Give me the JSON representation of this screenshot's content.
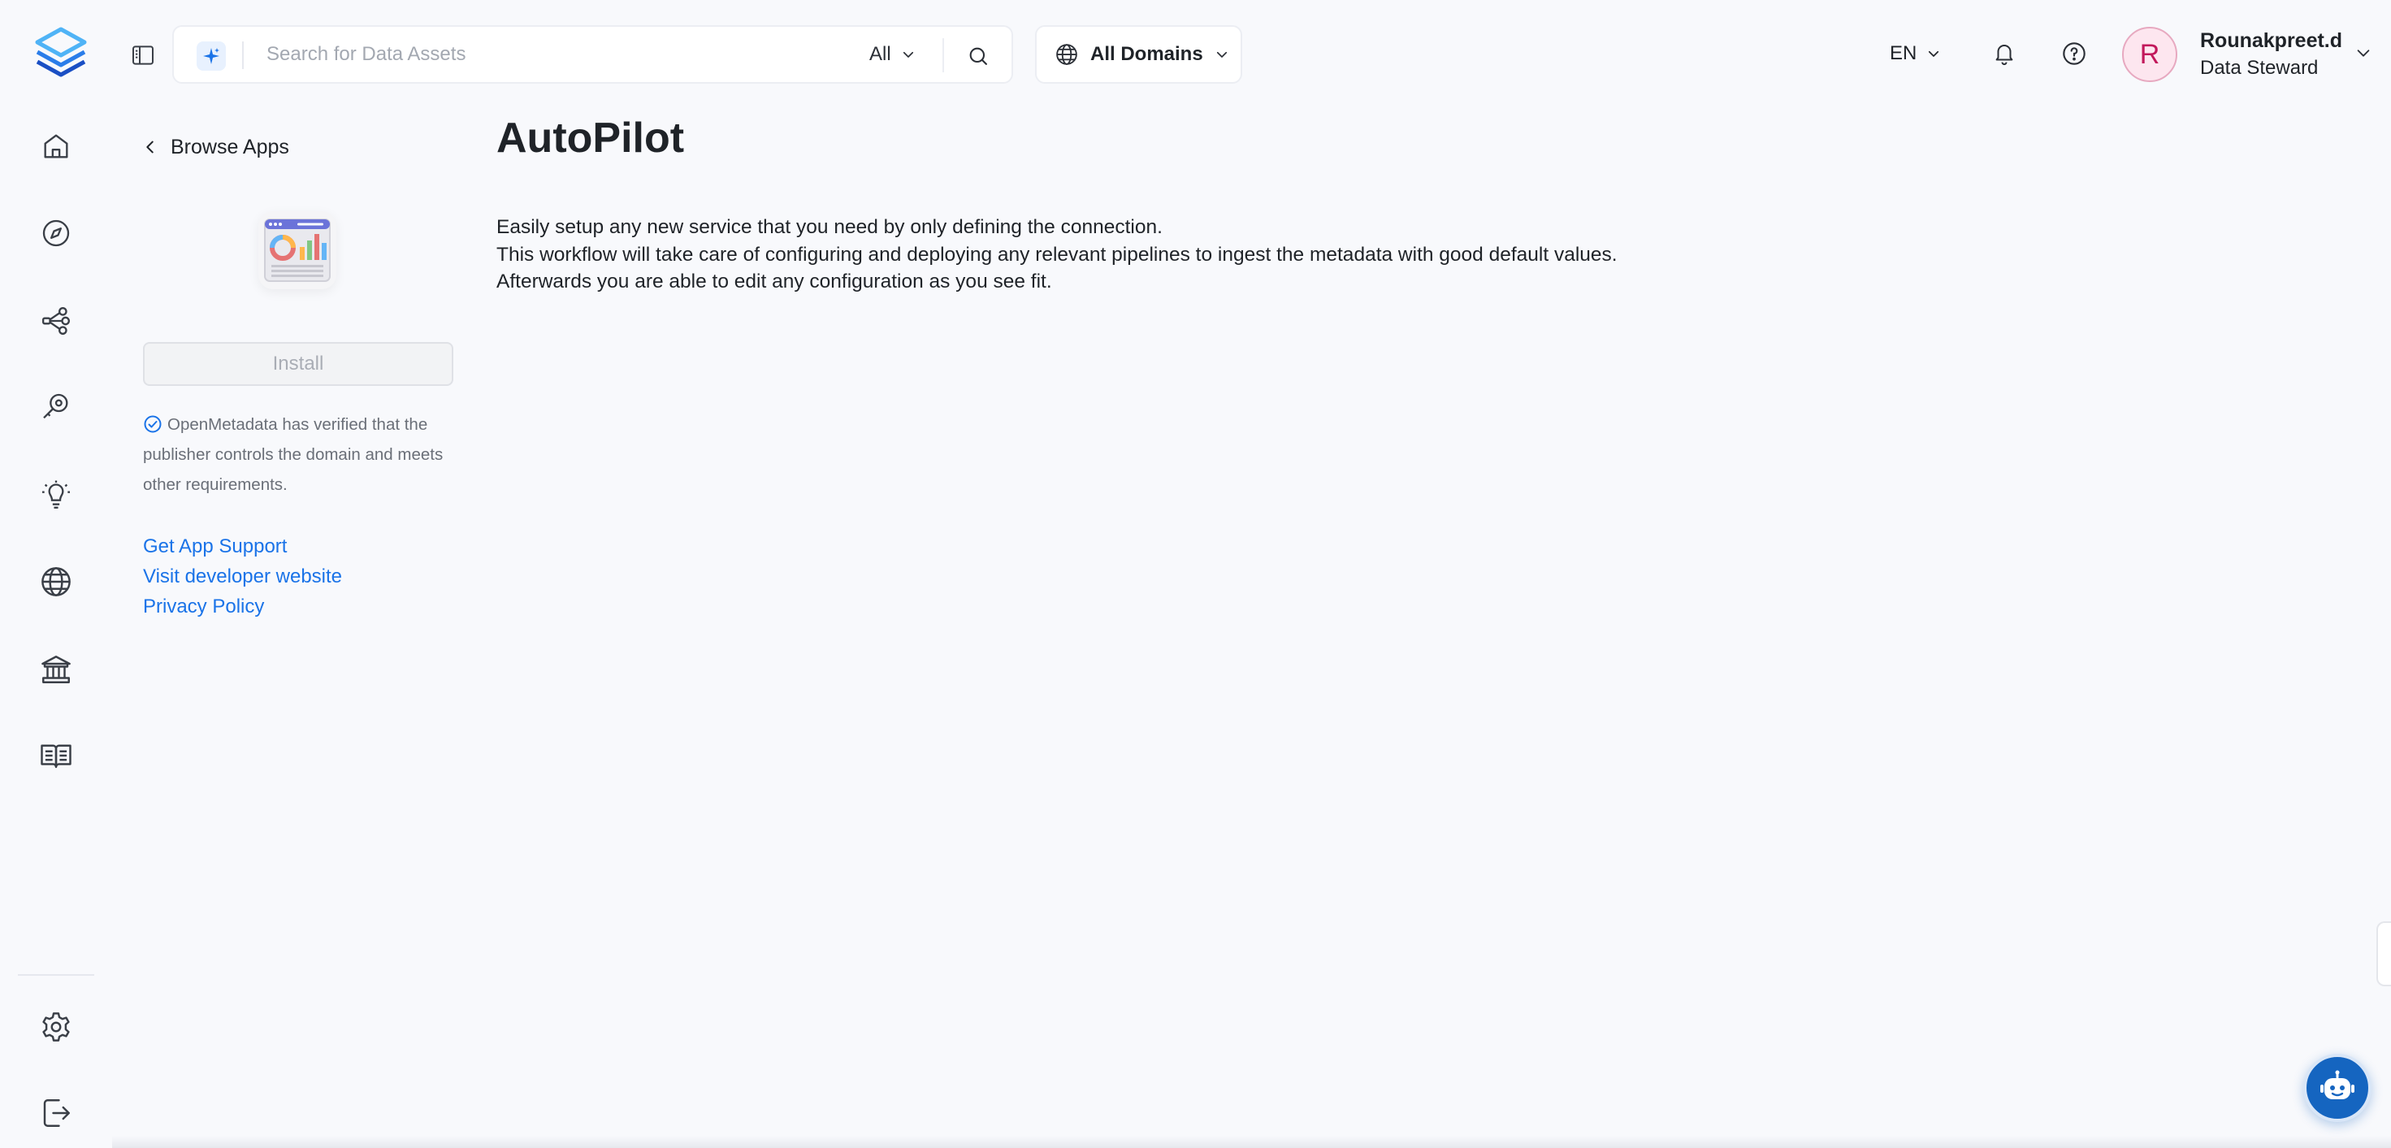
{
  "header": {
    "search": {
      "placeholder": "Search for Data Assets",
      "value": "",
      "filter_label": "All"
    },
    "domain_selector": "All Domains",
    "language": "EN",
    "user": {
      "initial": "R",
      "name": "Rounakpreet.d",
      "role": "Data Steward"
    }
  },
  "nav": {
    "items": [
      "home-icon",
      "explore-icon",
      "lineage-icon",
      "observability-icon",
      "insights-icon",
      "domains-icon",
      "governance-icon",
      "glossary-icon"
    ],
    "bottom_items": [
      "settings-icon",
      "logout-icon"
    ]
  },
  "app_sidebar": {
    "back_label": "Browse Apps",
    "install_label": "Install",
    "verified_text": "OpenMetadata has verified that the publisher controls the domain and meets other requirements.",
    "links": [
      "Get App Support",
      "Visit developer website",
      "Privacy Policy"
    ]
  },
  "main": {
    "title": "AutoPilot",
    "description": [
      "Easily setup any new service that you need by only defining the connection.",
      "This workflow will take care of configuring and deploying any relevant pipelines to ingest the metadata with good default values.",
      "Afterwards you are able to edit any configuration as you see fit."
    ]
  },
  "colors": {
    "accent": "#1a73e8",
    "chat_button": "#1565c0",
    "avatar_bg": "#fde6ef",
    "avatar_text": "#c2185b"
  }
}
